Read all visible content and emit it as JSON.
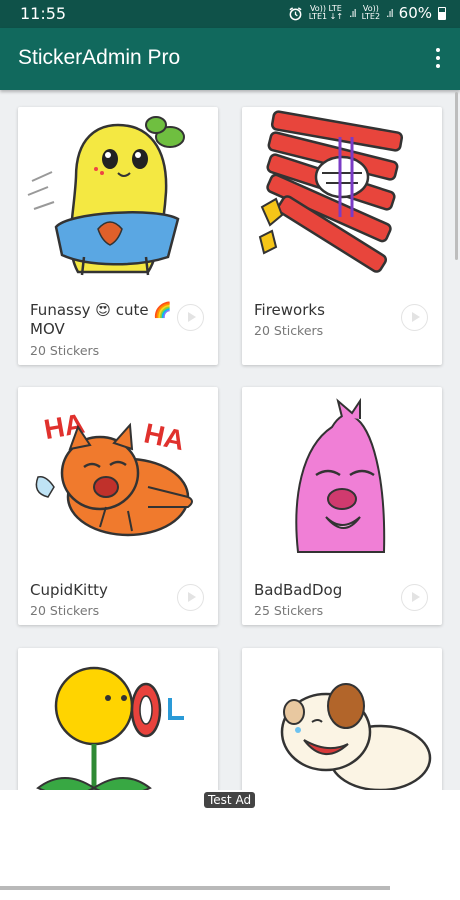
{
  "status_bar": {
    "time": "11:55",
    "sim1_top": "Vo)) LTE",
    "sim1_bottom": "LTE1 ↓↑",
    "sim2_top": "Vo))",
    "sim2_bottom": "LTE2",
    "battery": "60%",
    "icons": [
      "alarm-icon",
      "signal-icon",
      "battery-icon"
    ]
  },
  "app_bar": {
    "title": "StickerAdmin Pro",
    "menu_icon": "overflow-menu-icon"
  },
  "packs": [
    {
      "name": "Funassy 😍 cute 🌈 MOV",
      "count": "20 Stickers",
      "art": "yellow-pear-mascot"
    },
    {
      "name": "Fireworks",
      "count": "20 Stickers",
      "art": "firecracker-character"
    },
    {
      "name": "CupidKitty",
      "count": "20 Stickers",
      "art": "laughing-orange-cat",
      "art_text": "HA"
    },
    {
      "name": "BadBadDog",
      "count": "25 Stickers",
      "art": "pink-dog"
    },
    {
      "name": "",
      "count": "",
      "art": "sunflower-character"
    },
    {
      "name": "",
      "count": "",
      "art": "laughing-white-dog"
    }
  ],
  "ad": {
    "label": "Test Ad"
  },
  "colors": {
    "status_bar": "#0f5249",
    "app_bar": "#11695d",
    "background": "#eef0f2"
  }
}
